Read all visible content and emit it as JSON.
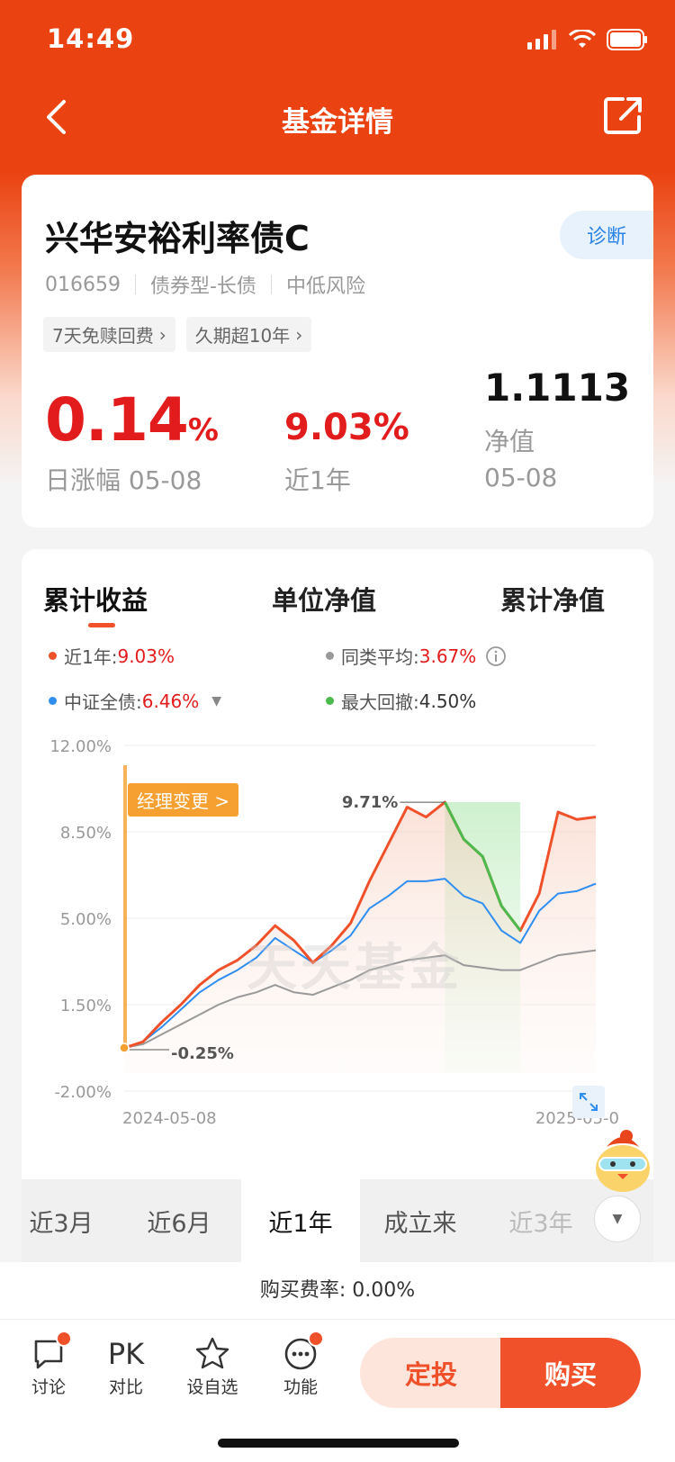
{
  "status": {
    "time": "14:49"
  },
  "nav": {
    "title": "基金详情"
  },
  "fund": {
    "name": "兴华安裕利率债C",
    "code": "016659",
    "category": "债券型-长债",
    "risk": "中低风险",
    "diagnose_label": "诊断",
    "tags": [
      "7天免赎回费",
      "久期超10年"
    ],
    "daily_change_value": "0.14",
    "daily_change_unit": "%",
    "daily_change_label": "日涨幅 05-08",
    "year_return": "9.03%",
    "year_return_label": "近1年",
    "nav_value": "1.1113",
    "nav_label": "净值",
    "nav_date": "05-08"
  },
  "chart_tabs": [
    "累计收益",
    "单位净值",
    "累计净值"
  ],
  "legend": [
    {
      "label": "近1年:",
      "value": "9.03%",
      "color": "#f0512a",
      "value_color": "#e21c1c"
    },
    {
      "label": "同类平均:",
      "value": "3.67%",
      "color": "#999999",
      "value_color": "#e21c1c"
    },
    {
      "label": "中证全债:",
      "value": "6.46%",
      "color": "#2f8ef0",
      "value_color": "#e21c1c"
    },
    {
      "label": "最大回撤:",
      "value": "4.50%",
      "color": "#4cba4c",
      "value_color": "#333333"
    }
  ],
  "chart_data": {
    "type": "line",
    "y_ticks": [
      "12.00%",
      "8.50%",
      "5.00%",
      "1.50%",
      "-2.00%"
    ],
    "ylim": [
      -2.0,
      12.0
    ],
    "x_labels": [
      "2024-05-08",
      "2025-05-0"
    ],
    "annotations": {
      "peak": "9.71%",
      "start": "-0.25%",
      "manager_change": "经理变更 >"
    },
    "watermark": "天天基金",
    "series": [
      {
        "name": "近1年",
        "color": "#f0512a",
        "values": [
          -0.25,
          0.0,
          0.8,
          1.5,
          2.3,
          2.9,
          3.3,
          3.9,
          4.7,
          4.1,
          3.2,
          3.9,
          4.8,
          6.5,
          8.0,
          9.5,
          9.1,
          9.7,
          8.2,
          7.5,
          5.5,
          4.5,
          6.0,
          9.3,
          9.0,
          9.1
        ]
      },
      {
        "name": "中证全债",
        "color": "#2f8ef0",
        "values": [
          -0.25,
          0.0,
          0.6,
          1.3,
          2.0,
          2.5,
          2.9,
          3.4,
          4.2,
          3.7,
          3.2,
          3.7,
          4.3,
          5.4,
          5.9,
          6.5,
          6.5,
          6.6,
          5.9,
          5.6,
          4.5,
          4.0,
          5.3,
          6.0,
          6.1,
          6.4
        ]
      },
      {
        "name": "同类平均",
        "color": "#999999",
        "values": [
          -0.25,
          -0.1,
          0.3,
          0.7,
          1.1,
          1.5,
          1.8,
          2.0,
          2.3,
          2.0,
          1.9,
          2.2,
          2.5,
          2.9,
          3.1,
          3.3,
          3.4,
          3.5,
          3.1,
          3.0,
          2.9,
          2.9,
          3.2,
          3.5,
          3.6,
          3.7
        ]
      }
    ],
    "drawdown_range": [
      17,
      21
    ]
  },
  "ranges": [
    "近3月",
    "近6月",
    "近1年",
    "成立来",
    "近3年"
  ],
  "active_range": 2,
  "fee": {
    "text": "购买费率: 0.00%"
  },
  "bottom": {
    "discuss": "讨论",
    "compare": "对比",
    "compare_icon": "PK",
    "watch": "设自选",
    "more": "功能",
    "auto_invest": "定投",
    "buy": "购买"
  }
}
